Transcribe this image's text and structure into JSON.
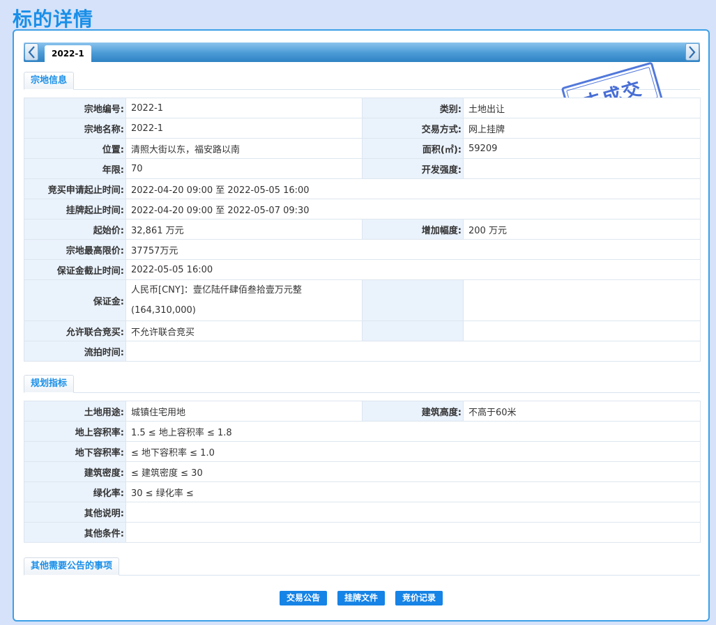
{
  "page": {
    "title": "标的详情"
  },
  "tabs": {
    "active": "2022-1"
  },
  "stamp": {
    "text": "未成交",
    "color": "#2f5bd0"
  },
  "sections": {
    "land_info": "宗地信息",
    "planning": "规划指标",
    "other": "其他需要公告的事项"
  },
  "land": {
    "parcel_no": {
      "label": "宗地编号:",
      "value": "2022-1"
    },
    "category": {
      "label": "类别:",
      "value": "土地出让"
    },
    "parcel_name": {
      "label": "宗地名称:",
      "value": "2022-1"
    },
    "trade_mode": {
      "label": "交易方式:",
      "value": "网上挂牌"
    },
    "location": {
      "label": "位置:",
      "value": "清照大街以东，福安路以南"
    },
    "area": {
      "label": "面积(㎡):",
      "value": "59209"
    },
    "term": {
      "label": "年限:",
      "value": "70"
    },
    "dev_intensity": {
      "label": "开发强度:",
      "value": ""
    },
    "bid_apply_period": {
      "label": "竞买申请起止时间:",
      "value": "2022-04-20 09:00 至 2022-05-05 16:00"
    },
    "listing_period": {
      "label": "挂牌起止时间:",
      "value": "2022-04-20 09:00 至 2022-05-07 09:30"
    },
    "start_price": {
      "label": "起始价:",
      "value": "32,861 万元"
    },
    "increment": {
      "label": "增加幅度:",
      "value": "200 万元"
    },
    "max_price": {
      "label": "宗地最高限价:",
      "value": "37757万元"
    },
    "deposit_deadline": {
      "label": "保证金截止时间:",
      "value": "2022-05-05 16:00"
    },
    "deposit": {
      "label": "保证金:",
      "value_line1": "人民币[CNY]：壹亿陆仟肆佰叁拾壹万元整",
      "value_line2": "(164,310,000)"
    },
    "joint_bid": {
      "label": "允许联合竞买:",
      "value": "不允许联合竞买"
    },
    "failed_time": {
      "label": "流拍时间:",
      "value": ""
    }
  },
  "planning": {
    "land_use": {
      "label": "土地用途:",
      "value": "城镇住宅用地"
    },
    "building_height": {
      "label": "建筑高度:",
      "value": "不高于60米"
    },
    "far_above": {
      "label": "地上容积率:",
      "value": "1.5 ≤ 地上容积率 ≤ 1.8"
    },
    "far_below": {
      "label": "地下容积率:",
      "value": "≤ 地下容积率 ≤ 1.0"
    },
    "density": {
      "label": "建筑密度:",
      "value": "≤ 建筑密度 ≤ 30"
    },
    "green": {
      "label": "绿化率:",
      "value": "30 ≤ 绿化率 ≤"
    },
    "other_desc": {
      "label": "其他说明:",
      "value": ""
    },
    "other_cond": {
      "label": "其他条件:",
      "value": ""
    }
  },
  "buttons": {
    "announcement": "交易公告",
    "listing_docs": "挂牌文件",
    "bid_records": "竞价记录"
  },
  "colors": {
    "accent": "#1a8fe8",
    "button": "#1683e6",
    "label_bg": "#eaf2fc"
  }
}
